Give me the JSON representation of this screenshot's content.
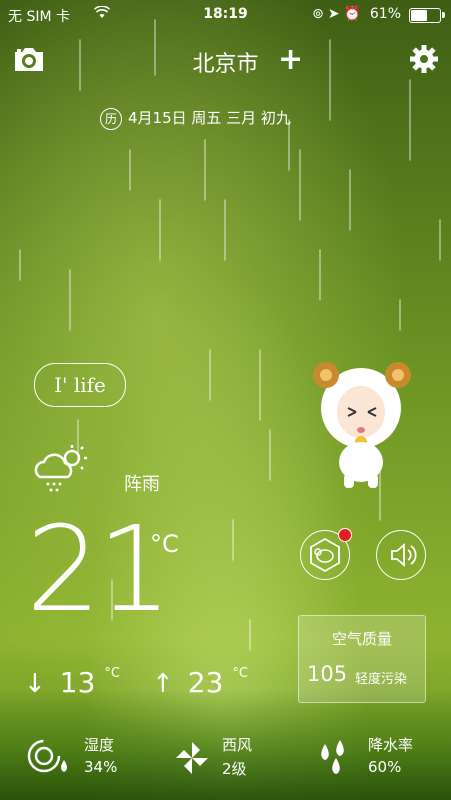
{
  "status_bar": {
    "carrier": "无 SIM 卡",
    "time": "18:19",
    "battery_percent": "61%",
    "battery_level": 0.61
  },
  "header": {
    "city": "北京市",
    "add_label": "+"
  },
  "date": {
    "badge": "历",
    "text": "4月15日 周五  三月 初九"
  },
  "ilife": {
    "brand": "I' life"
  },
  "weather": {
    "description": "阵雨",
    "temperature": "21",
    "unit": "°C",
    "low": "13",
    "high": "23",
    "low_unit": "°C",
    "high_unit": "°C"
  },
  "air_quality": {
    "title": "空气质量",
    "value": "105",
    "level": "轻度污染"
  },
  "details": {
    "humidity_label": "湿度",
    "humidity_value": "34%",
    "wind_label": "西风",
    "wind_value": "2级",
    "precip_label": "降水率",
    "precip_value": "60%"
  },
  "icons": {
    "camera": "camera-icon",
    "settings": "gear-icon",
    "weather": "cloud-sun-rain-icon",
    "sheep": "sheep-mascot-icon",
    "voice": "speaker-icon",
    "humidity": "humidity-gauge-icon",
    "wind": "pinwheel-icon",
    "precip": "raindrops-icon"
  }
}
